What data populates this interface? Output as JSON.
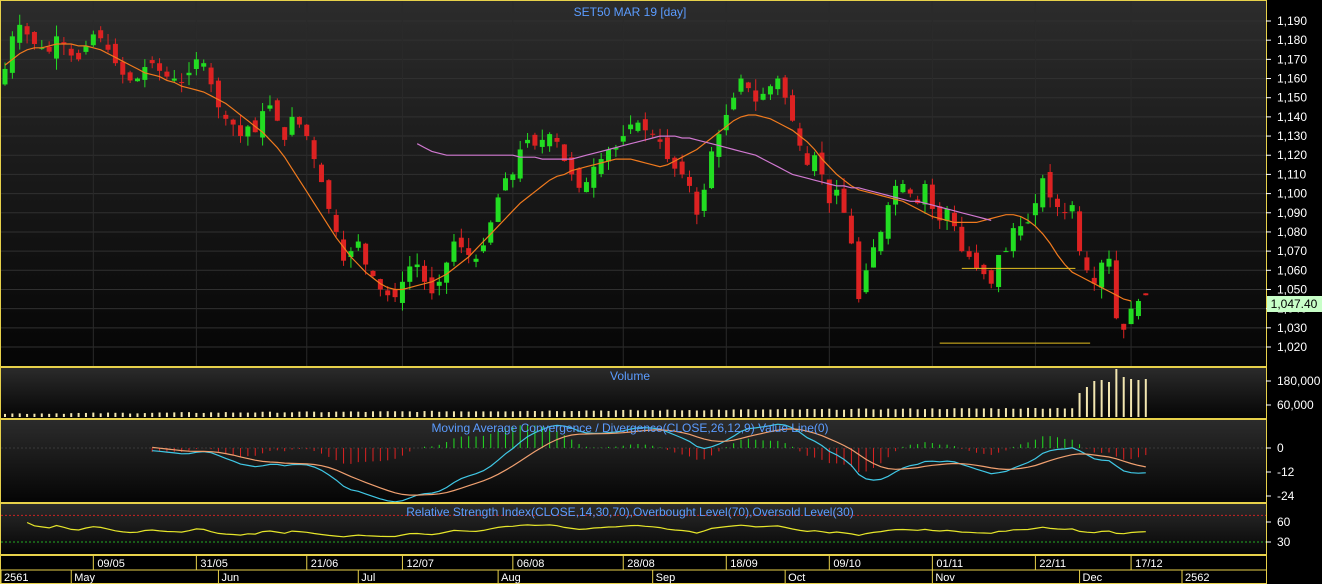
{
  "chart_data": {
    "type": "candlestick",
    "title": "SET50 MAR 19   [day]",
    "last_price": "1,047.40",
    "colors": {
      "background": "#000000",
      "panel_gradient_top": "#2a2a2a",
      "border": "#e7d14a",
      "up": "#22dd22",
      "down": "#dd2222",
      "ma_short": "#f07a1e",
      "ma_long": "#d078d0",
      "volume": "#f2e6b0",
      "macd_line": "#40c8e6",
      "signal_line": "#f0a070",
      "rsi": "#e6e62a",
      "overbought": "#cc2222",
      "oversold": "#22aa22",
      "title": "#5b9cff",
      "support": "#e6c020"
    },
    "price_panel": {
      "ylim": [
        1013,
        1195
      ],
      "yticks": [
        "1,190",
        "1,180",
        "1,170",
        "1,160",
        "1,150",
        "1,140",
        "1,130",
        "1,120",
        "1,110",
        "1,100",
        "1,090",
        "1,080",
        "1,070",
        "1,060",
        "1,050",
        "1,040",
        "1,030",
        "1,020"
      ],
      "ytick_values": [
        1190,
        1180,
        1170,
        1160,
        1150,
        1140,
        1130,
        1120,
        1110,
        1100,
        1090,
        1080,
        1070,
        1060,
        1050,
        1040,
        1030,
        1020
      ],
      "horizontal_lines": [
        {
          "value": 1061,
          "from_bar": 130,
          "to_bar": 140
        },
        {
          "value": 1022,
          "from_bar": 127,
          "to_bar": 142
        }
      ],
      "close": [
        1165,
        1182,
        1188,
        1183,
        1178,
        1176,
        1174,
        1182,
        1178,
        1172,
        1170,
        1177,
        1183,
        1181,
        1175,
        1168,
        1162,
        1159,
        1160,
        1166,
        1168,
        1164,
        1161,
        1160,
        1158,
        1163,
        1170,
        1168,
        1157,
        1145,
        1139,
        1136,
        1130,
        1135,
        1132,
        1143,
        1146,
        1138,
        1128,
        1140,
        1136,
        1130,
        1118,
        1106,
        1092,
        1080,
        1065,
        1070,
        1075,
        1063,
        1057,
        1050,
        1047,
        1046,
        1054,
        1062,
        1063,
        1054,
        1048,
        1054,
        1064,
        1075,
        1072,
        1068,
        1066,
        1073,
        1085,
        1098,
        1108,
        1110,
        1123,
        1128,
        1125,
        1128,
        1131,
        1127,
        1117,
        1110,
        1103,
        1106,
        1114,
        1118,
        1123,
        1124,
        1130,
        1136,
        1137,
        1133,
        1131,
        1127,
        1118,
        1113,
        1110,
        1104,
        1089,
        1102,
        1122,
        1131,
        1141,
        1150,
        1160,
        1155,
        1148,
        1152,
        1156,
        1160,
        1150,
        1138,
        1125,
        1115,
        1120,
        1110,
        1095,
        1102,
        1090,
        1074,
        1045,
        1060,
        1072,
        1080,
        1094,
        1104,
        1105,
        1100,
        1095,
        1105,
        1092,
        1086,
        1092,
        1083,
        1070,
        1067,
        1061,
        1058,
        1053,
        1068,
        1070,
        1082,
        1083,
        1085,
        1095,
        1108,
        1098,
        1093,
        1090,
        1094,
        1070,
        1060,
        1053,
        1064,
        1066,
        1035,
        1029,
        1040,
        1044,
        1047
      ],
      "ma_short": [
        1167,
        1170,
        1173,
        1175,
        1176,
        1176,
        1177,
        1178,
        1178,
        1178,
        1177,
        1177,
        1176,
        1175,
        1173,
        1171,
        1169,
        1167,
        1165,
        1163,
        1162,
        1161,
        1159,
        1158,
        1156,
        1155,
        1154,
        1153,
        1151,
        1149,
        1147,
        1144,
        1141,
        1138,
        1135,
        1132,
        1128,
        1124,
        1119,
        1113,
        1107,
        1101,
        1095,
        1089,
        1083,
        1077,
        1072,
        1067,
        1063,
        1059,
        1056,
        1053,
        1051,
        1050,
        1050,
        1051,
        1052,
        1053,
        1054,
        1056,
        1058,
        1061,
        1064,
        1067,
        1071,
        1075,
        1079,
        1083,
        1087,
        1091,
        1095,
        1098,
        1101,
        1104,
        1107,
        1109,
        1110,
        1112,
        1113,
        1114,
        1115,
        1116,
        1117,
        1118,
        1118,
        1118,
        1117,
        1116,
        1115,
        1114,
        1115,
        1117,
        1119,
        1121,
        1123,
        1126,
        1129,
        1132,
        1135,
        1138,
        1140,
        1141,
        1141,
        1140,
        1139,
        1137,
        1135,
        1133,
        1130,
        1127,
        1123,
        1118,
        1114,
        1110,
        1107,
        1104,
        1102,
        1101,
        1100,
        1099,
        1098,
        1097,
        1096,
        1094,
        1092,
        1090,
        1088,
        1087,
        1086,
        1085,
        1085,
        1085,
        1085,
        1086,
        1087,
        1088,
        1089,
        1089,
        1088,
        1086,
        1083,
        1079,
        1074,
        1068,
        1063,
        1059,
        1057,
        1055,
        1053,
        1051,
        1049,
        1047,
        1045,
        1044
      ],
      "ma_long_start": 56,
      "ma_long": [
        1126,
        1124,
        1122,
        1121,
        1120,
        1120,
        1120,
        1120,
        1120,
        1120,
        1120,
        1120,
        1120,
        1120,
        1119,
        1119,
        1119,
        1118,
        1118,
        1118,
        1118,
        1118,
        1119,
        1120,
        1121,
        1122,
        1123,
        1124,
        1125,
        1126,
        1127,
        1128,
        1129,
        1130,
        1130,
        1130,
        1129,
        1129,
        1128,
        1127,
        1126,
        1125,
        1124,
        1123,
        1122,
        1121,
        1120,
        1118,
        1116,
        1114,
        1112,
        1110,
        1109,
        1108,
        1107,
        1106,
        1105,
        1104,
        1104,
        1103,
        1103,
        1102,
        1101,
        1100,
        1099,
        1098,
        1097,
        1096,
        1096,
        1095,
        1094,
        1093,
        1092,
        1091,
        1090,
        1089,
        1088,
        1087,
        1086
      ],
      "candle_count": 160
    },
    "volume_panel": {
      "title": "Volume",
      "yticks": [
        "180,000",
        "60,000"
      ],
      "ytick_values": [
        180000,
        60000
      ],
      "ylim": [
        0,
        240000
      ],
      "big_bars": [
        120000,
        150000,
        180000,
        185000,
        175000,
        240000,
        200000,
        190000,
        185000,
        190000
      ]
    },
    "macd_panel": {
      "title": "Moving Average Convergence / Divergence(CLOSE,26,12,9) Value Line(0)",
      "yticks": [
        "0",
        "-12",
        "-24"
      ],
      "ytick_values": [
        0,
        -12,
        -24
      ],
      "ylim": [
        -30,
        12
      ]
    },
    "rsi_panel": {
      "title": "Relative Strength Index(CLOSE,14,30,70),Overbought Level(70),Oversold Level(30)",
      "yticks": [
        "60",
        "30"
      ],
      "ytick_values": [
        60,
        30
      ],
      "ylim": [
        15,
        85
      ]
    },
    "x_axis": {
      "top_row": [
        {
          "label": "09/05",
          "bar": 12
        },
        {
          "label": "31/05",
          "bar": 26
        },
        {
          "label": "21/06",
          "bar": 41
        },
        {
          "label": "12/07",
          "bar": 54
        },
        {
          "label": "06/08",
          "bar": 69
        },
        {
          "label": "28/08",
          "bar": 84
        },
        {
          "label": "18/09",
          "bar": 98
        },
        {
          "label": "09/10",
          "bar": 112
        },
        {
          "label": "01/11",
          "bar": 126
        },
        {
          "label": "22/11",
          "bar": 140
        },
        {
          "label": "17/12",
          "bar": 153
        }
      ],
      "bottom_row": [
        {
          "label": "2561",
          "bar": 0
        },
        {
          "label": "May",
          "bar": 9
        },
        {
          "label": "Jun",
          "bar": 29
        },
        {
          "label": "Jul",
          "bar": 48
        },
        {
          "label": "Aug",
          "bar": 67
        },
        {
          "label": "Sep",
          "bar": 88
        },
        {
          "label": "Oct",
          "bar": 106
        },
        {
          "label": "Nov",
          "bar": 126
        },
        {
          "label": "Dec",
          "bar": 146
        },
        {
          "label": "2562",
          "bar": 164
        }
      ]
    }
  }
}
